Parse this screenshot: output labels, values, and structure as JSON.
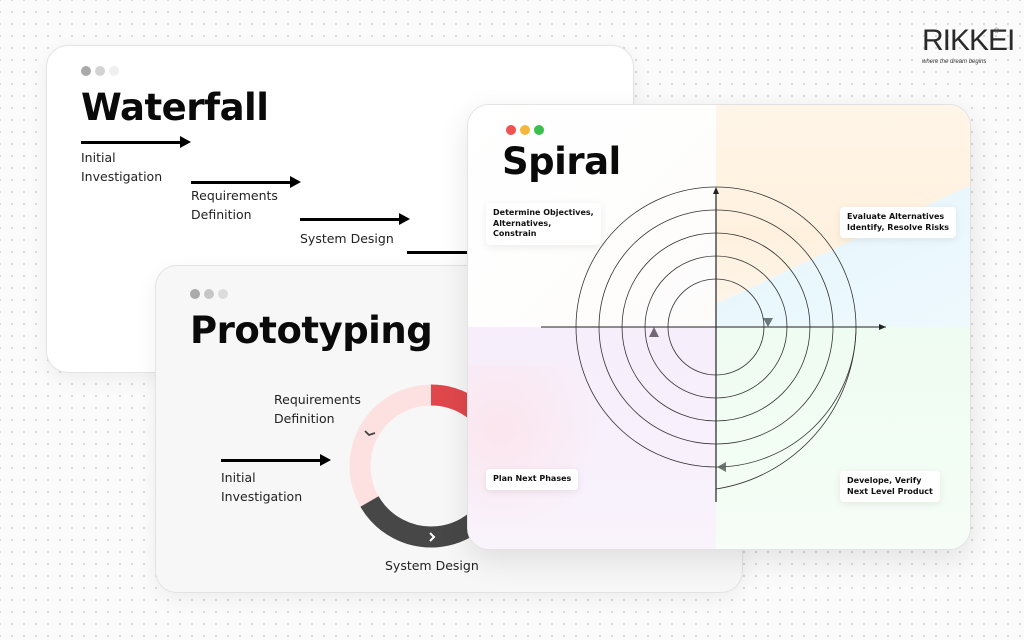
{
  "brand": {
    "logo_text": "RIKKEI",
    "registered_mark": "®",
    "tagline": "where the dream begins"
  },
  "colors": {
    "traffic_red": "#ef5350",
    "traffic_yellow": "#f5b73b",
    "traffic_green": "#3bbf4f",
    "gray_dot_1": "#a9a9a9",
    "gray_dot_2": "#cfcfcf",
    "gray_dot_3": "#ececec",
    "prototype_red": "#e0474c",
    "prototype_pink": "#fde1e1",
    "prototype_dark": "#474747"
  },
  "windows": {
    "waterfall": {
      "title": "Waterfall",
      "steps": [
        {
          "label": "Initial\nInvestigation"
        },
        {
          "label": "Requirements\nDefinition"
        },
        {
          "label": "System Design"
        },
        {
          "label": ""
        }
      ]
    },
    "prototyping": {
      "title": "Prototyping",
      "entry_label": "Initial\nInvestigation",
      "ring_labels": {
        "top": "Requirements\nDefinition",
        "bottom": "System Design"
      },
      "ring_segments": [
        {
          "name": "requirements",
          "color": "#fde1e1"
        },
        {
          "name": "system-design",
          "color": "#474747"
        },
        {
          "name": "current-phase",
          "color": "#e0474c"
        }
      ]
    },
    "spiral": {
      "title": "Spiral",
      "quadrants": {
        "top_left": "Determine Objectives,\nAlternatives,\nConstrain",
        "top_right": "Evaluate Alternatives\nIdentify, Resolve Risks",
        "bottom_left": "Plan Next Phases",
        "bottom_right": "Develope, Verify\nNext Level Product"
      },
      "loops": 5
    }
  }
}
